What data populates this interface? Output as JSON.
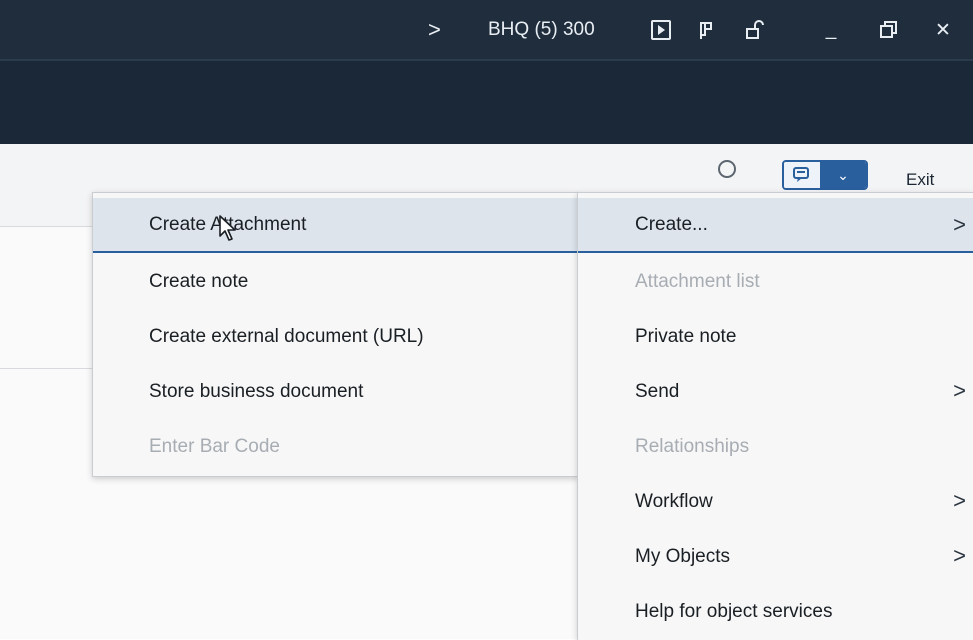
{
  "titlebar": {
    "chevron": ">",
    "system_id": "BHQ (5) 300",
    "icons": [
      "play-box-icon",
      "customize-icon",
      "unlock-icon",
      "minimize-icon",
      "restore-icon",
      "close-icon"
    ],
    "minimize": "_",
    "close": "✕"
  },
  "toolbar": {
    "exit_label": "Exit",
    "search_icon": "search-icon",
    "gos_button_icon": "services-for-object-icon",
    "dropdown_glyph": "⌄"
  },
  "left_menu": {
    "items": [
      {
        "label": "Create Attachment",
        "state": "selected"
      },
      {
        "label": "Create note",
        "state": "enabled"
      },
      {
        "label": "Create external document (URL)",
        "state": "enabled"
      },
      {
        "label": "Store business document",
        "state": "enabled"
      },
      {
        "label": "Enter Bar Code",
        "state": "disabled"
      }
    ]
  },
  "right_menu": {
    "items": [
      {
        "label": "Create...",
        "state": "selected",
        "submenu": true
      },
      {
        "label": "Attachment list",
        "state": "disabled",
        "submenu": false
      },
      {
        "label": "Private note",
        "state": "enabled",
        "submenu": false
      },
      {
        "label": "Send",
        "state": "enabled",
        "submenu": true
      },
      {
        "label": "Relationships",
        "state": "disabled",
        "submenu": false
      },
      {
        "label": "Workflow",
        "state": "enabled",
        "submenu": true
      },
      {
        "label": "My Objects",
        "state": "enabled",
        "submenu": true
      },
      {
        "label": "Help for object services",
        "state": "enabled",
        "submenu": false
      }
    ],
    "submenu_arrow": ">"
  },
  "colors": {
    "title_bg": "#1f2d3d",
    "header_bg": "#1b2838",
    "accent": "#2a5f9e",
    "selected_bg": "#dde4ec",
    "disabled_text": "#a7adb3"
  }
}
